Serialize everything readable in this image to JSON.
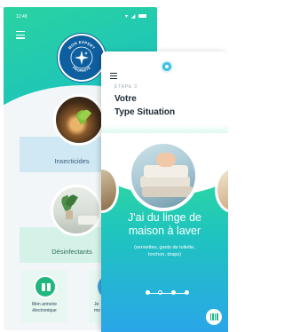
{
  "back_screen": {
    "status_time": "12:48",
    "badge": {
      "top_text": "MON EXPERT",
      "bottom_text": "PROPRETE",
      "icon": "sparkle-icon"
    },
    "categories": [
      {
        "label": "Insecticides",
        "image": "plant-in-soil-photo"
      },
      {
        "label": "Désinfectants",
        "image": "living-room-plant-photo"
      }
    ],
    "bottom_tiles": [
      {
        "label_line1": "Mon armoire",
        "label_line2": "électronique",
        "icon": "wardrobe-icon"
      },
      {
        "label_line1": "Je",
        "label_line2": "mo",
        "icon": "blue-circle-icon"
      }
    ],
    "colors": {
      "header_start": "#2ad3a0",
      "header_end": "#22b8d8",
      "badge": "#0e5fa0"
    }
  },
  "front_screen": {
    "step_label": "ÉTAPE 3",
    "title_line1": "Votre",
    "title_line2": "Type Situation",
    "situation_title_line1": "J'ai du linge de",
    "situation_title_line2": "maison à laver",
    "situation_subtitle_line1": "(serviettes, gants de toilette,",
    "situation_subtitle_line2": "torchon, draps)",
    "pagination": {
      "current": 2,
      "total": 4
    },
    "icons": {
      "menu": "hamburger-menu-icon",
      "avatar": "avatar-icon",
      "scan": "barcode-scan-icon"
    },
    "colors": {
      "gradient_top": "#2bd6a3",
      "gradient_bottom": "#2aa6e8"
    }
  }
}
